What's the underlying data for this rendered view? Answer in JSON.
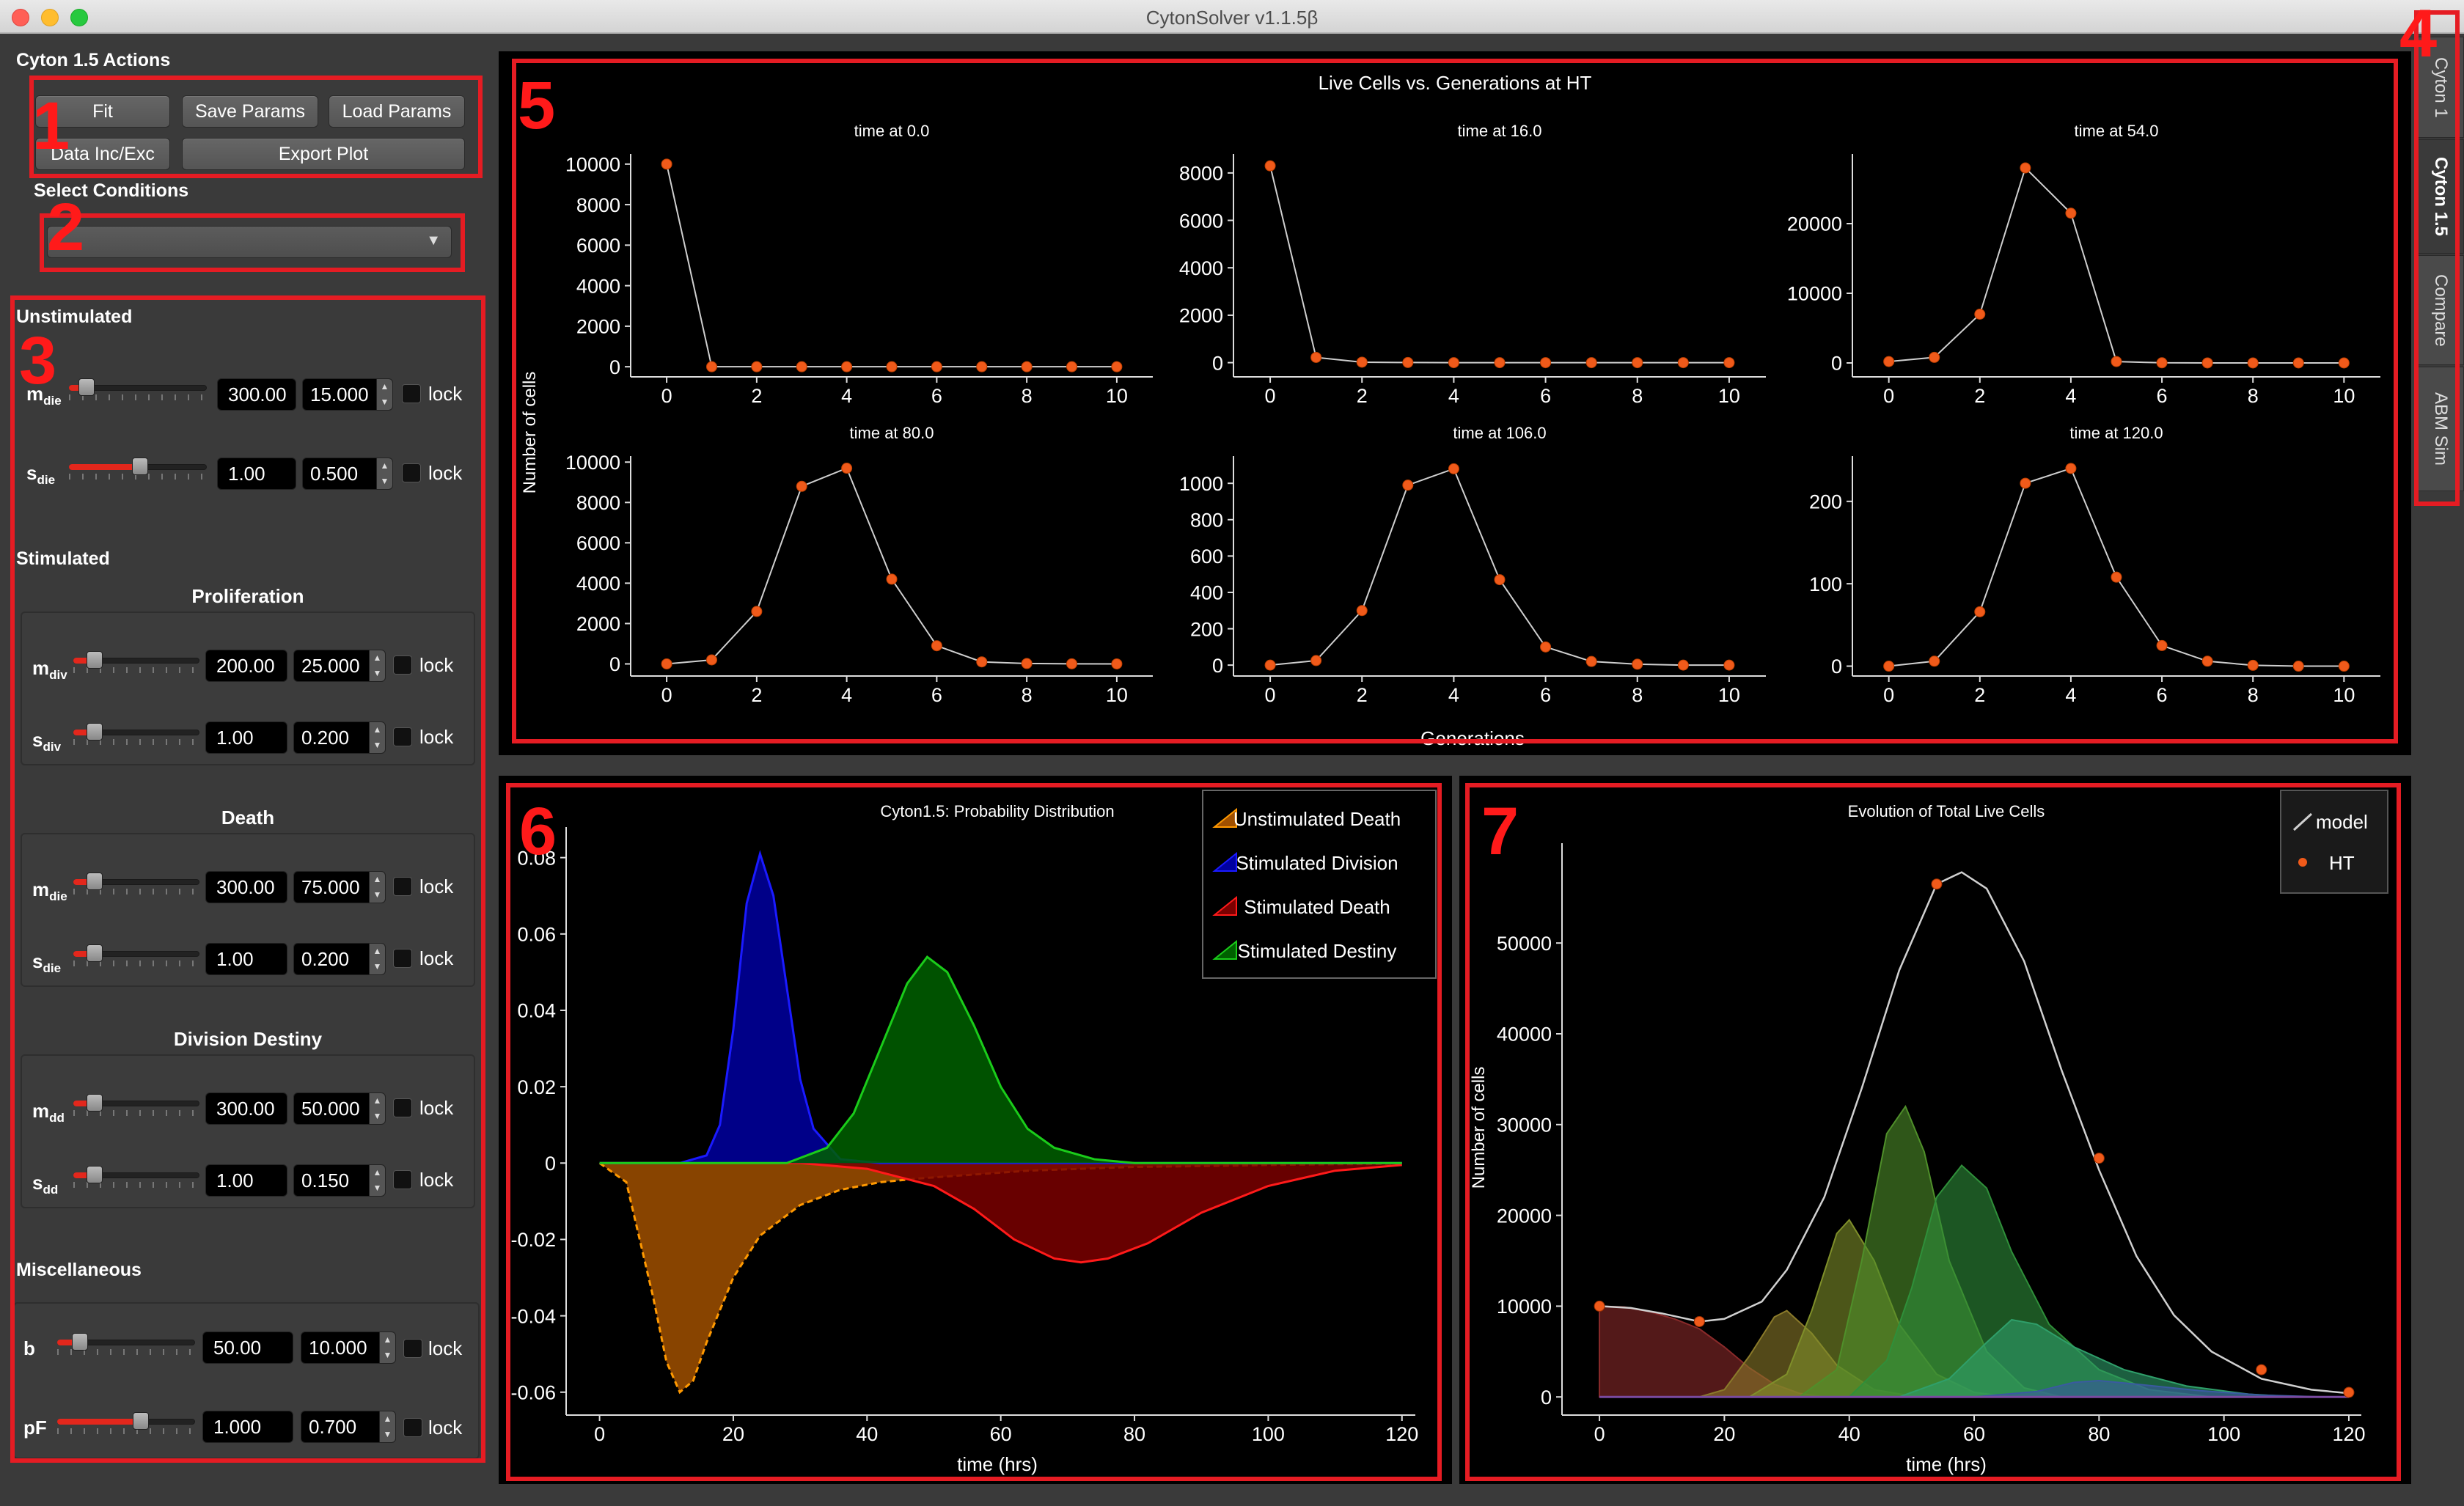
{
  "window": {
    "title": "CytonSolver v1.1.5β"
  },
  "actions": {
    "title": "Cyton 1.5 Actions",
    "fit": "Fit",
    "save": "Save Params",
    "load": "Load Params",
    "data": "Data Inc/Exc",
    "export": "Export Plot"
  },
  "conditions": {
    "title": "Select Conditions",
    "selected": ""
  },
  "params": {
    "unstimulated": {
      "title": "Unstimulated",
      "mdie": {
        "value": "300.00",
        "spin": "15.000"
      },
      "sdie": {
        "value": "1.00",
        "spin": "0.500"
      }
    },
    "stimulated": {
      "title": "Stimulated",
      "proliferation": "Proliferation",
      "mdiv": {
        "value": "200.00",
        "spin": "25.000"
      },
      "sdiv": {
        "value": "1.00",
        "spin": "0.200"
      },
      "death": "Death",
      "mdie": {
        "value": "300.00",
        "spin": "75.000"
      },
      "sdie": {
        "value": "1.00",
        "spin": "0.200"
      },
      "destiny": "Division Destiny",
      "mdd": {
        "value": "300.00",
        "spin": "50.000"
      },
      "sdd": {
        "value": "1.00",
        "spin": "0.150"
      }
    },
    "misc": {
      "title": "Miscellaneous",
      "b": {
        "label": "b",
        "value": "50.00",
        "spin": "10.000"
      },
      "pf": {
        "label": "pF",
        "value": "1.000",
        "spin": "0.700"
      }
    },
    "lock": "lock",
    "sym": {
      "m": "m",
      "s": "s",
      "die": "die",
      "div": "div",
      "dd": "dd"
    },
    "slider_levels": {
      "u_mdie": 0.08,
      "u_sdie": 0.52,
      "s_mdiv": 0.12,
      "s_sdiv": 0.12,
      "s_mdie": 0.12,
      "s_sdie": 0.12,
      "s_mdd": 0.12,
      "s_sdd": 0.12,
      "b": 0.12,
      "pf": 0.62
    }
  },
  "tabs": [
    "Cyton 1",
    "Cyton 1.5",
    "Compare",
    "ABM Sim"
  ],
  "active_tab": "Cyton 1.5",
  "annotations": [
    "1",
    "2",
    "3",
    "4",
    "5",
    "6",
    "7"
  ],
  "colors": {
    "annotation": "#e51c23",
    "marker": "#f05a1a"
  },
  "chart_data": [
    {
      "type": "line",
      "title": "Live Cells vs. Generations at HT",
      "xlabel": "Generations",
      "ylabel": "Number of cells",
      "subplots": [
        {
          "title": "time at 0.0",
          "x": [
            0,
            1,
            2,
            3,
            4,
            5,
            6,
            7,
            8,
            9,
            10
          ],
          "y": [
            10000,
            0,
            0,
            0,
            0,
            0,
            0,
            0,
            0,
            0,
            0
          ],
          "ylim": [
            -500,
            10500
          ],
          "yticks": [
            0,
            2000,
            4000,
            6000,
            8000,
            10000
          ],
          "xticks": [
            0,
            2,
            4,
            6,
            8,
            10
          ]
        },
        {
          "title": "time at 16.0",
          "x": [
            0,
            1,
            2,
            3,
            4,
            5,
            6,
            7,
            8,
            9,
            10
          ],
          "y": [
            8300,
            220,
            20,
            5,
            0,
            0,
            0,
            0,
            0,
            0,
            0
          ],
          "ylim": [
            -600,
            8800
          ],
          "yticks": [
            0,
            2000,
            4000,
            6000,
            8000
          ],
          "xticks": [
            0,
            2,
            4,
            6,
            8,
            10
          ]
        },
        {
          "title": "time at 54.0",
          "x": [
            0,
            1,
            2,
            3,
            4,
            5,
            6,
            7,
            8,
            9,
            10
          ],
          "y": [
            200,
            800,
            7000,
            28000,
            21500,
            200,
            20,
            5,
            0,
            0,
            0
          ],
          "ylim": [
            -2000,
            30000
          ],
          "yticks": [
            0,
            10000,
            20000
          ],
          "xticks": [
            0,
            2,
            4,
            6,
            8,
            10
          ]
        },
        {
          "title": "time at 80.0",
          "x": [
            0,
            1,
            2,
            3,
            4,
            5,
            6,
            7,
            8,
            9,
            10
          ],
          "y": [
            0,
            200,
            2600,
            8800,
            9700,
            4200,
            900,
            100,
            20,
            5,
            0
          ],
          "ylim": [
            -600,
            10300
          ],
          "yticks": [
            0,
            2000,
            4000,
            6000,
            8000,
            10000
          ],
          "xticks": [
            0,
            2,
            4,
            6,
            8,
            10
          ]
        },
        {
          "title": "time at 106.0",
          "x": [
            0,
            1,
            2,
            3,
            4,
            5,
            6,
            7,
            8,
            9,
            10
          ],
          "y": [
            0,
            25,
            300,
            990,
            1080,
            470,
            100,
            20,
            5,
            0,
            0
          ],
          "ylim": [
            -60,
            1150
          ],
          "yticks": [
            0,
            200,
            400,
            600,
            800,
            1000
          ],
          "xticks": [
            0,
            2,
            4,
            6,
            8,
            10
          ]
        },
        {
          "title": "time at 120.0",
          "x": [
            0,
            1,
            2,
            3,
            4,
            5,
            6,
            7,
            8,
            9,
            10
          ],
          "y": [
            0,
            6,
            66,
            222,
            240,
            108,
            25,
            6,
            1,
            0,
            0
          ],
          "ylim": [
            -12,
            255
          ],
          "yticks": [
            0,
            100,
            200
          ],
          "xticks": [
            0,
            2,
            4,
            6,
            8,
            10
          ]
        }
      ]
    },
    {
      "type": "area",
      "title": "Cyton1.5: Probability Distribution",
      "xlabel": "time (hrs)",
      "ylabel": "",
      "xlim": [
        -5,
        122
      ],
      "ylim": [
        -0.066,
        0.088
      ],
      "xticks": [
        0,
        20,
        40,
        60,
        80,
        100,
        120
      ],
      "yticks": [
        0.08,
        0.06,
        0.04,
        0.02,
        0,
        -0.02,
        -0.04,
        -0.06
      ],
      "ytick_labels": [
        "0.08",
        "0.06",
        "0.04",
        "0.02",
        "0",
        "-0.02",
        "-0.04",
        "-0.06"
      ],
      "series": [
        {
          "name": "Unstimulated Death",
          "color": "#ff9900",
          "fill": "#a05000",
          "x": [
            0,
            4,
            8,
            10,
            12,
            14,
            16,
            20,
            24,
            30,
            36,
            42,
            48,
            56,
            64,
            72,
            80,
            90,
            100,
            110,
            120
          ],
          "y": [
            0,
            -0.005,
            -0.035,
            -0.052,
            -0.06,
            -0.057,
            -0.047,
            -0.03,
            -0.019,
            -0.011,
            -0.007,
            -0.005,
            -0.004,
            -0.003,
            -0.002,
            -0.0015,
            -0.001,
            -0.0008,
            -0.0005,
            -0.0003,
            -0.0002
          ]
        },
        {
          "name": "Stimulated Division",
          "color": "#1a1aff",
          "fill": "#0000a0",
          "x": [
            0,
            12,
            16,
            18,
            20,
            22,
            24,
            26,
            28,
            30,
            32,
            36,
            42,
            50,
            120
          ],
          "y": [
            0,
            0,
            0.002,
            0.01,
            0.035,
            0.068,
            0.081,
            0.07,
            0.046,
            0.022,
            0.009,
            0.001,
            0,
            0,
            0
          ]
        },
        {
          "name": "Stimulated Death",
          "color": "#ff1a1a",
          "fill": "#7a0000",
          "x": [
            0,
            30,
            40,
            50,
            56,
            62,
            68,
            72,
            76,
            82,
            90,
            100,
            110,
            120
          ],
          "y": [
            0,
            0,
            -0.0015,
            -0.006,
            -0.012,
            -0.02,
            -0.025,
            -0.026,
            -0.025,
            -0.021,
            -0.013,
            -0.006,
            -0.002,
            -0.0005
          ]
        },
        {
          "name": "Stimulated Destiny",
          "color": "#1acc1a",
          "fill": "#006000",
          "x": [
            0,
            28,
            34,
            38,
            42,
            46,
            49,
            52,
            56,
            60,
            64,
            68,
            74,
            80,
            90,
            120
          ],
          "y": [
            0,
            0,
            0.004,
            0.013,
            0.03,
            0.047,
            0.054,
            0.05,
            0.036,
            0.02,
            0.009,
            0.004,
            0.001,
            0,
            0,
            0
          ]
        }
      ]
    },
    {
      "type": "area",
      "title": "Evolution of Total Live Cells",
      "xlabel": "time (hrs)",
      "ylabel": "Number of cells",
      "xlim": [
        -6,
        122
      ],
      "ylim": [
        -2000,
        61000
      ],
      "xticks": [
        0,
        20,
        40,
        60,
        80,
        100,
        120
      ],
      "yticks": [
        0,
        10000,
        20000,
        30000,
        40000,
        50000,
        60000
      ],
      "series": [
        {
          "name": "model",
          "color": "#d0d0d0",
          "x": [
            0,
            5,
            10,
            16,
            20,
            26,
            30,
            36,
            42,
            48,
            54,
            58,
            62,
            68,
            74,
            80,
            86,
            92,
            98,
            106,
            114,
            120
          ],
          "y": [
            10000,
            9800,
            9200,
            8300,
            8600,
            10500,
            14000,
            22000,
            34000,
            47000,
            56500,
            57800,
            56000,
            48000,
            36000,
            25000,
            15500,
            9000,
            5000,
            2000,
            800,
            400
          ]
        },
        {
          "name": "HT",
          "type": "scatter",
          "color": "#f05a1a",
          "x": [
            0,
            16,
            54,
            80,
            106,
            120
          ],
          "y": [
            10000,
            8300,
            56500,
            26300,
            3000,
            500
          ]
        }
      ],
      "generations": [
        {
          "x": [
            0,
            4,
            8,
            12,
            16,
            20,
            24,
            28,
            32,
            36
          ],
          "y": [
            10000,
            9900,
            9400,
            8600,
            7500,
            5500,
            3200,
            1400,
            400,
            0
          ],
          "fill": "#8a2a2a"
        },
        {
          "x": [
            16,
            20,
            24,
            28,
            30,
            34,
            38,
            44,
            50,
            56
          ],
          "y": [
            0,
            800,
            4500,
            8800,
            9500,
            7000,
            3500,
            800,
            100,
            0
          ],
          "fill": "#8a7a2a"
        },
        {
          "x": [
            24,
            30,
            34,
            38,
            40,
            44,
            48,
            54,
            60,
            66
          ],
          "y": [
            0,
            2500,
            9500,
            18000,
            19500,
            15000,
            8000,
            2500,
            500,
            0
          ],
          "fill": "#7f8f2a"
        },
        {
          "x": [
            32,
            38,
            42,
            46,
            49,
            52,
            56,
            62,
            68,
            74
          ],
          "y": [
            0,
            3000,
            15000,
            29000,
            32000,
            27000,
            15000,
            5000,
            1000,
            0
          ],
          "fill": "#4f8f2a"
        },
        {
          "x": [
            40,
            46,
            50,
            54,
            58,
            62,
            66,
            72,
            80,
            88,
            98
          ],
          "y": [
            0,
            4000,
            12000,
            22000,
            25500,
            23000,
            16000,
            8000,
            3000,
            800,
            0
          ],
          "fill": "#2f8f3a"
        },
        {
          "x": [
            48,
            56,
            62,
            66,
            70,
            76,
            84,
            94,
            104,
            112
          ],
          "y": [
            0,
            2000,
            6000,
            8500,
            8000,
            5500,
            3000,
            1200,
            300,
            0
          ],
          "fill": "#2f9f6a"
        },
        {
          "x": [
            60,
            70,
            76,
            80,
            86,
            96,
            106,
            116
          ],
          "y": [
            0,
            600,
            1600,
            1800,
            1400,
            700,
            200,
            0
          ],
          "fill": "#3a5aa0"
        }
      ]
    }
  ]
}
